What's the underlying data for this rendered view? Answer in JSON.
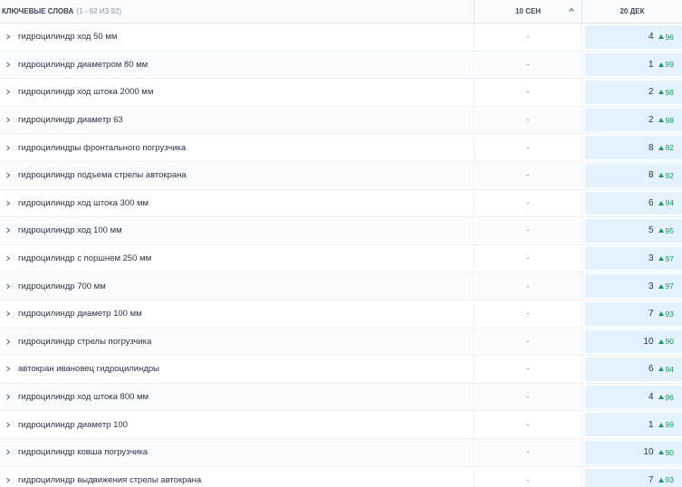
{
  "header": {
    "keywords_label": "КЛЮЧЕВЫЕ СЛОВА",
    "keywords_range": "(1 - 92 ИЗ 92)",
    "date1": "10 СЕН",
    "date2": "20 ДЕК"
  },
  "colors": {
    "highlight": "#e3f2fc",
    "positive_change": "#1f9a62",
    "border": "#e3e7ee"
  },
  "rows": [
    {
      "keyword": "гидроцилиндр ход 50 мм",
      "prev": "-",
      "pos": "4",
      "change": "96"
    },
    {
      "keyword": "гидроцилиндр диаметром 80 мм",
      "prev": "-",
      "pos": "1",
      "change": "99"
    },
    {
      "keyword": "гидроцилиндр ход штока 2000 мм",
      "prev": "-",
      "pos": "2",
      "change": "98"
    },
    {
      "keyword": "гидроцилиндр диаметр 63",
      "prev": "-",
      "pos": "2",
      "change": "98"
    },
    {
      "keyword": "гидроцилиндры фронтального погрузчика",
      "prev": "-",
      "pos": "8",
      "change": "92"
    },
    {
      "keyword": "гидроцилиндр подъема стрелы автокрана",
      "prev": "-",
      "pos": "8",
      "change": "92"
    },
    {
      "keyword": "гидроцилиндр ход штока 300 мм",
      "prev": "-",
      "pos": "6",
      "change": "94"
    },
    {
      "keyword": "гидроцилиндр ход 100 мм",
      "prev": "-",
      "pos": "5",
      "change": "95"
    },
    {
      "keyword": "гидроцилиндр с поршнем 250 мм",
      "prev": "-",
      "pos": "3",
      "change": "97"
    },
    {
      "keyword": "гидроцилиндр 700 мм",
      "prev": "-",
      "pos": "3",
      "change": "97"
    },
    {
      "keyword": "гидроцилиндр диаметр 100 мм",
      "prev": "-",
      "pos": "7",
      "change": "93"
    },
    {
      "keyword": "гидроцилиндр стрелы погрузчика",
      "prev": "-",
      "pos": "10",
      "change": "90"
    },
    {
      "keyword": "автокран ивановец гидроцилиндры",
      "prev": "-",
      "pos": "6",
      "change": "94"
    },
    {
      "keyword": "гидроцилиндр ход штока 800 мм",
      "prev": "-",
      "pos": "4",
      "change": "96"
    },
    {
      "keyword": "гидроцилиндр диаметр 100",
      "prev": "-",
      "pos": "1",
      "change": "99"
    },
    {
      "keyword": "гидроцилиндр ковша погрузчика",
      "prev": "-",
      "pos": "10",
      "change": "90"
    },
    {
      "keyword": "гидроцилиндр выдвижения стрелы автокрана",
      "prev": "-",
      "pos": "7",
      "change": "93"
    }
  ]
}
